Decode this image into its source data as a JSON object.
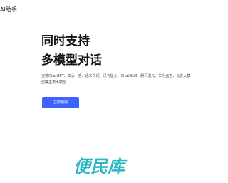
{
  "header": {
    "brand": "AI助手"
  },
  "hero": {
    "headline_line1": "同时支持",
    "headline_line2": "多模型对话",
    "subtitle": "支持ChatGPT、文心一言、通义千问、讯飞星火、ChatGLM、腾讯混元、华为盘古、云雀大模型等主流大模型",
    "cta_label": "立即使用"
  },
  "watermark": {
    "text": "便民库",
    "color": "#2bb7c4"
  },
  "colors": {
    "accent": "#3d63ff",
    "headline": "#141414",
    "body_text": "#3f4550",
    "background": "#ffffff"
  }
}
